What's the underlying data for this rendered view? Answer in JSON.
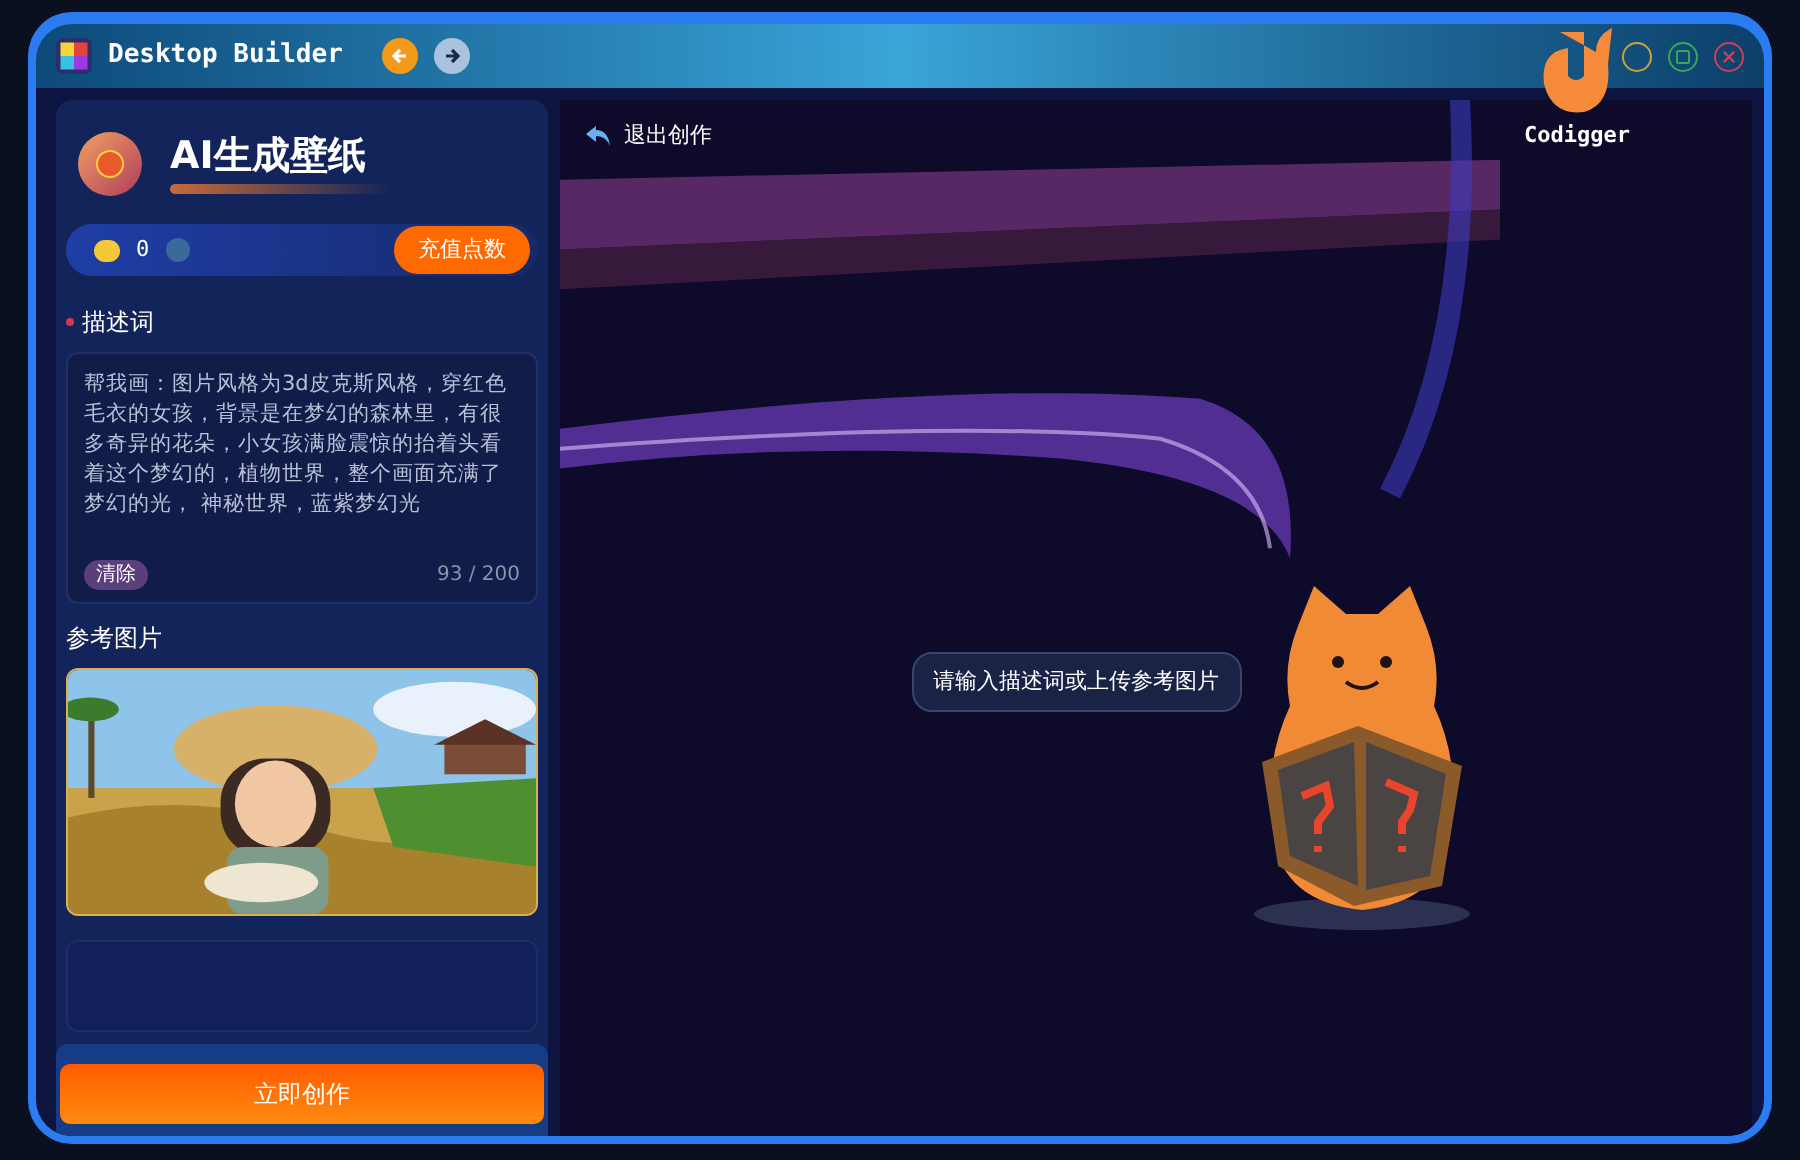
{
  "window": {
    "title": "Desktop Builder"
  },
  "logo": {
    "label": "Codigger"
  },
  "sidebar": {
    "title": "AI生成壁纸",
    "points": "0",
    "recharge_button": "充值点数",
    "prompt_label": "描述词",
    "prompt": {
      "value": "帮我画：图片风格为3d皮克斯风格，穿红色毛衣的女孩，背景是在梦幻的森林里，有很多奇异的花朵，小女孩满脸震惊的抬着头看着这个梦幻的，植物世界，整个画面充满了梦幻的光， 神秘世界，蓝紫梦幻光",
      "count": "93 / 200",
      "clear_button": "清除"
    },
    "reference_label": "参考图片",
    "create_button": "立即创作"
  },
  "main": {
    "exit_button": "退出创作",
    "hint": "请输入描述词或上传参考图片"
  }
}
